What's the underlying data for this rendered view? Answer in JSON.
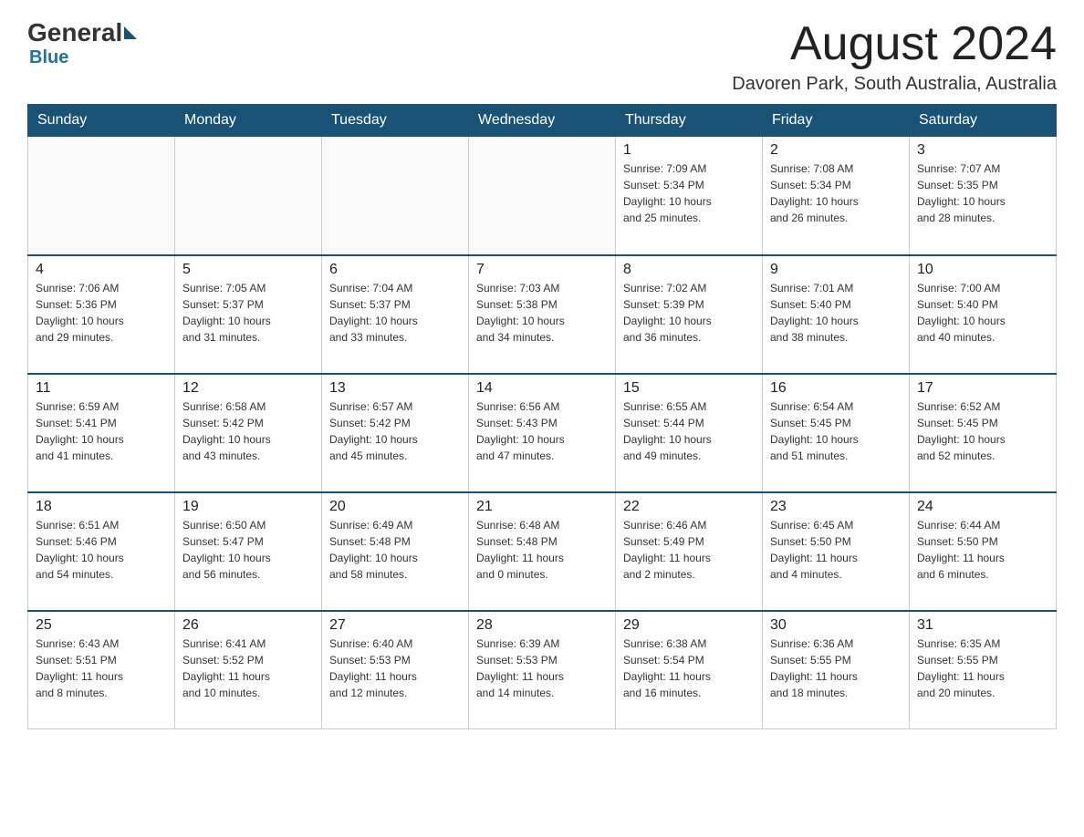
{
  "logo": {
    "general": "General",
    "blue": "Blue"
  },
  "title": "August 2024",
  "location": "Davoren Park, South Australia, Australia",
  "days_of_week": [
    "Sunday",
    "Monday",
    "Tuesday",
    "Wednesday",
    "Thursday",
    "Friday",
    "Saturday"
  ],
  "weeks": [
    [
      {
        "day": "",
        "info": ""
      },
      {
        "day": "",
        "info": ""
      },
      {
        "day": "",
        "info": ""
      },
      {
        "day": "",
        "info": ""
      },
      {
        "day": "1",
        "info": "Sunrise: 7:09 AM\nSunset: 5:34 PM\nDaylight: 10 hours\nand 25 minutes."
      },
      {
        "day": "2",
        "info": "Sunrise: 7:08 AM\nSunset: 5:34 PM\nDaylight: 10 hours\nand 26 minutes."
      },
      {
        "day": "3",
        "info": "Sunrise: 7:07 AM\nSunset: 5:35 PM\nDaylight: 10 hours\nand 28 minutes."
      }
    ],
    [
      {
        "day": "4",
        "info": "Sunrise: 7:06 AM\nSunset: 5:36 PM\nDaylight: 10 hours\nand 29 minutes."
      },
      {
        "day": "5",
        "info": "Sunrise: 7:05 AM\nSunset: 5:37 PM\nDaylight: 10 hours\nand 31 minutes."
      },
      {
        "day": "6",
        "info": "Sunrise: 7:04 AM\nSunset: 5:37 PM\nDaylight: 10 hours\nand 33 minutes."
      },
      {
        "day": "7",
        "info": "Sunrise: 7:03 AM\nSunset: 5:38 PM\nDaylight: 10 hours\nand 34 minutes."
      },
      {
        "day": "8",
        "info": "Sunrise: 7:02 AM\nSunset: 5:39 PM\nDaylight: 10 hours\nand 36 minutes."
      },
      {
        "day": "9",
        "info": "Sunrise: 7:01 AM\nSunset: 5:40 PM\nDaylight: 10 hours\nand 38 minutes."
      },
      {
        "day": "10",
        "info": "Sunrise: 7:00 AM\nSunset: 5:40 PM\nDaylight: 10 hours\nand 40 minutes."
      }
    ],
    [
      {
        "day": "11",
        "info": "Sunrise: 6:59 AM\nSunset: 5:41 PM\nDaylight: 10 hours\nand 41 minutes."
      },
      {
        "day": "12",
        "info": "Sunrise: 6:58 AM\nSunset: 5:42 PM\nDaylight: 10 hours\nand 43 minutes."
      },
      {
        "day": "13",
        "info": "Sunrise: 6:57 AM\nSunset: 5:42 PM\nDaylight: 10 hours\nand 45 minutes."
      },
      {
        "day": "14",
        "info": "Sunrise: 6:56 AM\nSunset: 5:43 PM\nDaylight: 10 hours\nand 47 minutes."
      },
      {
        "day": "15",
        "info": "Sunrise: 6:55 AM\nSunset: 5:44 PM\nDaylight: 10 hours\nand 49 minutes."
      },
      {
        "day": "16",
        "info": "Sunrise: 6:54 AM\nSunset: 5:45 PM\nDaylight: 10 hours\nand 51 minutes."
      },
      {
        "day": "17",
        "info": "Sunrise: 6:52 AM\nSunset: 5:45 PM\nDaylight: 10 hours\nand 52 minutes."
      }
    ],
    [
      {
        "day": "18",
        "info": "Sunrise: 6:51 AM\nSunset: 5:46 PM\nDaylight: 10 hours\nand 54 minutes."
      },
      {
        "day": "19",
        "info": "Sunrise: 6:50 AM\nSunset: 5:47 PM\nDaylight: 10 hours\nand 56 minutes."
      },
      {
        "day": "20",
        "info": "Sunrise: 6:49 AM\nSunset: 5:48 PM\nDaylight: 10 hours\nand 58 minutes."
      },
      {
        "day": "21",
        "info": "Sunrise: 6:48 AM\nSunset: 5:48 PM\nDaylight: 11 hours\nand 0 minutes."
      },
      {
        "day": "22",
        "info": "Sunrise: 6:46 AM\nSunset: 5:49 PM\nDaylight: 11 hours\nand 2 minutes."
      },
      {
        "day": "23",
        "info": "Sunrise: 6:45 AM\nSunset: 5:50 PM\nDaylight: 11 hours\nand 4 minutes."
      },
      {
        "day": "24",
        "info": "Sunrise: 6:44 AM\nSunset: 5:50 PM\nDaylight: 11 hours\nand 6 minutes."
      }
    ],
    [
      {
        "day": "25",
        "info": "Sunrise: 6:43 AM\nSunset: 5:51 PM\nDaylight: 11 hours\nand 8 minutes."
      },
      {
        "day": "26",
        "info": "Sunrise: 6:41 AM\nSunset: 5:52 PM\nDaylight: 11 hours\nand 10 minutes."
      },
      {
        "day": "27",
        "info": "Sunrise: 6:40 AM\nSunset: 5:53 PM\nDaylight: 11 hours\nand 12 minutes."
      },
      {
        "day": "28",
        "info": "Sunrise: 6:39 AM\nSunset: 5:53 PM\nDaylight: 11 hours\nand 14 minutes."
      },
      {
        "day": "29",
        "info": "Sunrise: 6:38 AM\nSunset: 5:54 PM\nDaylight: 11 hours\nand 16 minutes."
      },
      {
        "day": "30",
        "info": "Sunrise: 6:36 AM\nSunset: 5:55 PM\nDaylight: 11 hours\nand 18 minutes."
      },
      {
        "day": "31",
        "info": "Sunrise: 6:35 AM\nSunset: 5:55 PM\nDaylight: 11 hours\nand 20 minutes."
      }
    ]
  ]
}
